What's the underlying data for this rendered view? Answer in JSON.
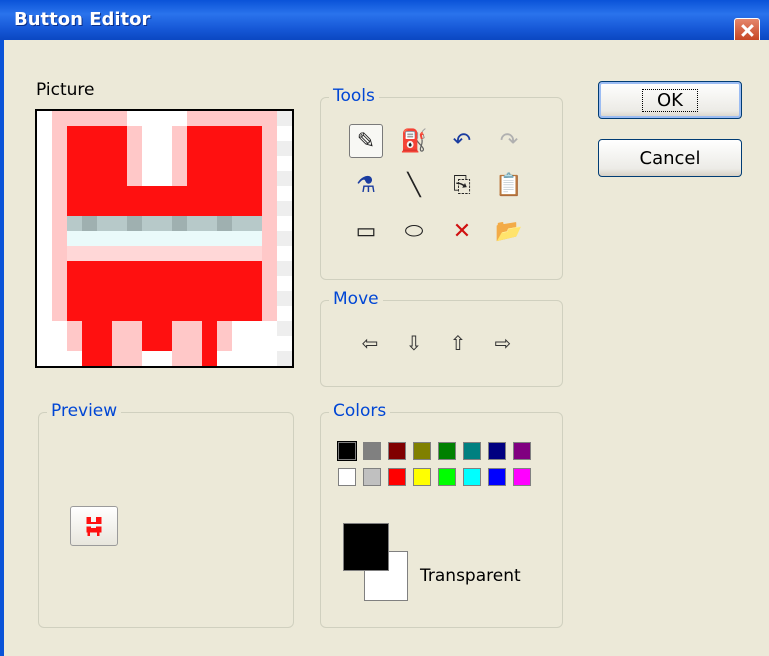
{
  "window": {
    "title": "Button Editor"
  },
  "picture": {
    "label": "Picture"
  },
  "preview": {
    "label": "Preview"
  },
  "tools": {
    "label": "Tools",
    "items": [
      {
        "name": "pencil-icon",
        "glyph": "✎",
        "selected": true
      },
      {
        "name": "fill-bucket-icon",
        "glyph": "⛽"
      },
      {
        "name": "undo-icon",
        "glyph": "↶"
      },
      {
        "name": "redo-icon",
        "glyph": "↷"
      },
      {
        "name": "eyedropper-icon",
        "glyph": "⚗"
      },
      {
        "name": "line-icon",
        "glyph": "╲"
      },
      {
        "name": "copy-icon",
        "glyph": "⎘"
      },
      {
        "name": "paste-icon",
        "glyph": "📋"
      },
      {
        "name": "rectangle-icon",
        "glyph": "▭"
      },
      {
        "name": "ellipse-icon",
        "glyph": "⬭"
      },
      {
        "name": "clear-icon",
        "glyph": "✕"
      },
      {
        "name": "open-folder-icon",
        "glyph": "📂"
      }
    ]
  },
  "move": {
    "label": "Move",
    "arrows": [
      {
        "name": "move-left-icon",
        "glyph": "⇦"
      },
      {
        "name": "move-down-icon",
        "glyph": "⇩"
      },
      {
        "name": "move-up-icon",
        "glyph": "⇧"
      },
      {
        "name": "move-right-icon",
        "glyph": "⇨"
      }
    ]
  },
  "colors": {
    "label": "Colors",
    "palette_row1": [
      "#000000",
      "#808080",
      "#800000",
      "#808000",
      "#008000",
      "#008080",
      "#000080",
      "#800080"
    ],
    "palette_row2": [
      "#ffffff",
      "#c0c0c0",
      "#ff0000",
      "#ffff00",
      "#00ff00",
      "#00ffff",
      "#0000ff",
      "#ff00ff"
    ],
    "foreground": "#000000",
    "background": "#ffffff",
    "transparent_label": "Transparent"
  },
  "buttons": {
    "ok_label": "OK",
    "cancel_label": "Cancel"
  }
}
